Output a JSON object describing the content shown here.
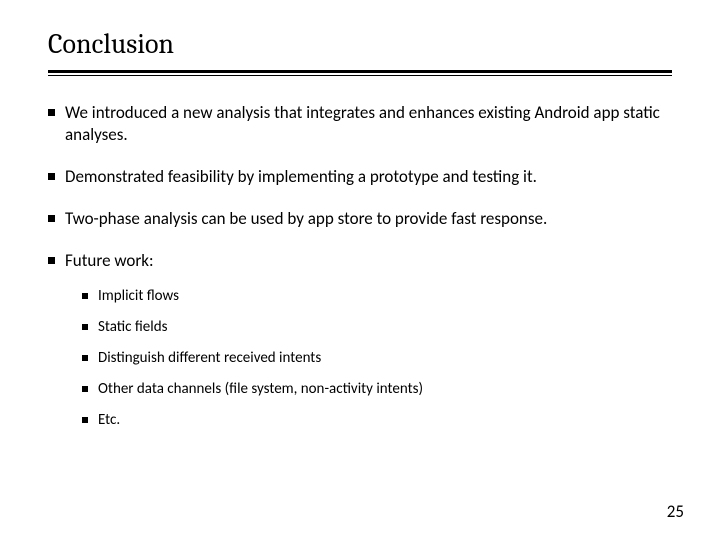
{
  "title": "Conclusion",
  "bullets": [
    "We introduced a new analysis that integrates and enhances existing Android app static analyses.",
    "Demonstrated feasibility by implementing a prototype and testing it.",
    "Two-phase analysis can be used by app store to provide fast response.",
    "Future work:"
  ],
  "sub_bullets": [
    "Implicit flows",
    "Static fields",
    "Distinguish different received intents",
    "Other data channels (file system, non-activity intents)",
    "Etc."
  ],
  "page_number": "25"
}
